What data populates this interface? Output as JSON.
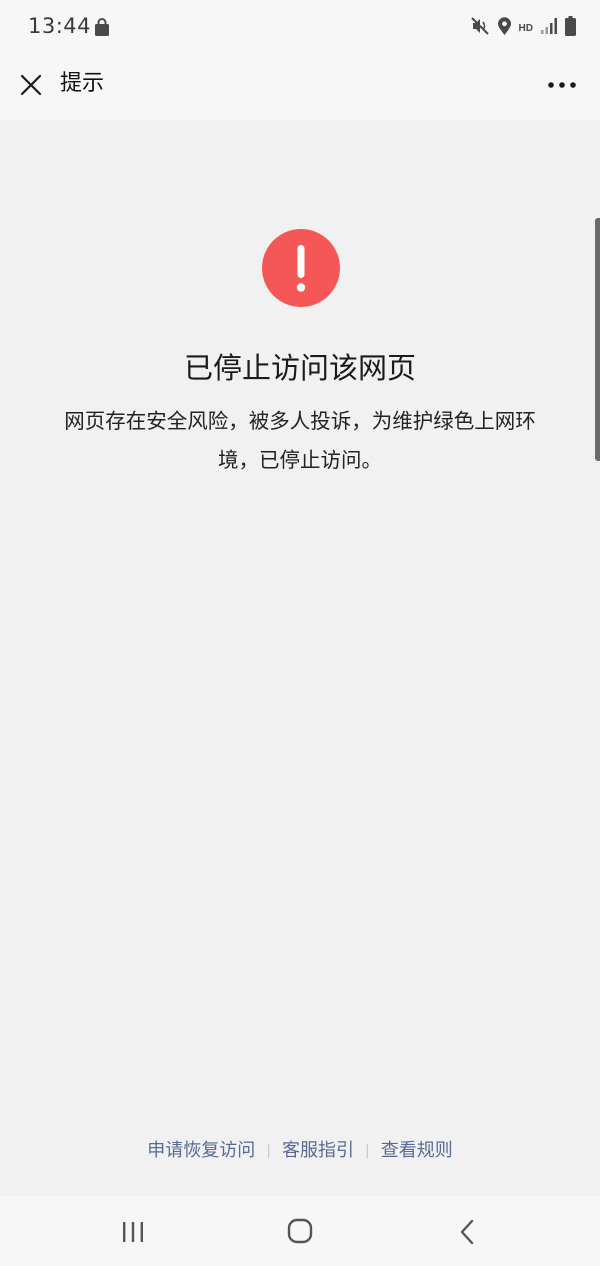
{
  "status_bar": {
    "time": "13:44",
    "hd": "HD",
    "icons": [
      "shopping-bag-icon",
      "mute-icon",
      "location-icon",
      "signal-icon",
      "battery-icon"
    ]
  },
  "header": {
    "title": "提示",
    "close_icon": "close-icon",
    "more_icon": "more-dots-icon"
  },
  "notice": {
    "icon": "exclamation-icon",
    "icon_color": "#f55656",
    "title": "已停止访问该网页",
    "description": "网页存在安全风险，被多人投诉，为维护绿色上网环境，已停止访问。"
  },
  "footer": {
    "links": [
      "申请恢复访问",
      "客服指引",
      "查看规则"
    ],
    "link_color": "#576b95"
  },
  "system_nav": {
    "icons": [
      "recents-icon",
      "home-icon",
      "back-icon"
    ]
  }
}
